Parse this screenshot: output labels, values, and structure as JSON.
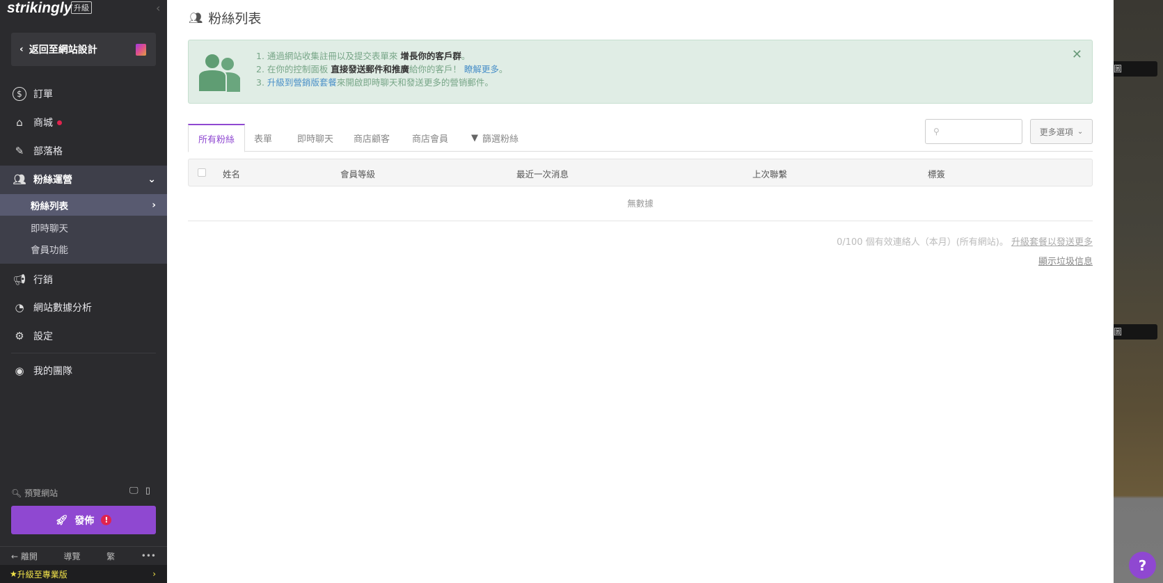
{
  "sidebar": {
    "logo": "strikingly",
    "upgrade_badge": "升級",
    "back_label": "返回至網站設計",
    "items": [
      {
        "label": "訂單"
      },
      {
        "label": "商城"
      },
      {
        "label": "部落格"
      },
      {
        "label": "粉絲運營"
      },
      {
        "label": "行銷"
      },
      {
        "label": "網站數據分析"
      },
      {
        "label": "設定"
      },
      {
        "label": "我的團隊"
      }
    ],
    "subitems": [
      {
        "label": "粉絲列表"
      },
      {
        "label": "即時聊天"
      },
      {
        "label": "會員功能"
      }
    ],
    "preview_label": "預覽網站",
    "publish_label": "發佈",
    "bottom": {
      "leave": "離開",
      "tour": "導覽",
      "lang": "繁",
      "more": "•••"
    },
    "upgrade_pro": "升級至專業版"
  },
  "main": {
    "title": "粉絲列表",
    "banner": {
      "l1a": "1. 通過網站收集註冊以及提交表單來 ",
      "l1b": "增長你的客戶群",
      "l1c": "。",
      "l2a": "2. 在你的控制面板 ",
      "l2b": "直接發送郵件和推廣",
      "l2c": "給你的客戶！ ",
      "l2d": "瞭解更多",
      "l2e": "。",
      "l3a": "3. ",
      "l3b": "升級到營銷版套餐",
      "l3c": "來開啟即時聊天和發送更多的營销郵件。"
    },
    "tabs": [
      "所有粉絲",
      "表單",
      "即時聊天",
      "商店顧客",
      "商店會員",
      "篩選粉絲"
    ],
    "more_options": "更多選項",
    "columns": [
      "姓名",
      "會員等級",
      "最近一次消息",
      "上次聯繫",
      "標簽"
    ],
    "empty": "無數據",
    "quota": "0/100 個有效連絡人（本月）(所有網站)。",
    "quota_link": "升級套餐以發送更多",
    "spam": "顯示垃圾信息"
  },
  "right": {
    "btn": "圖",
    "help": "?"
  },
  "colors": {
    "accent": "#8f48d1",
    "sidebar": "#2b2b2e",
    "banner": "#e0ede5"
  }
}
